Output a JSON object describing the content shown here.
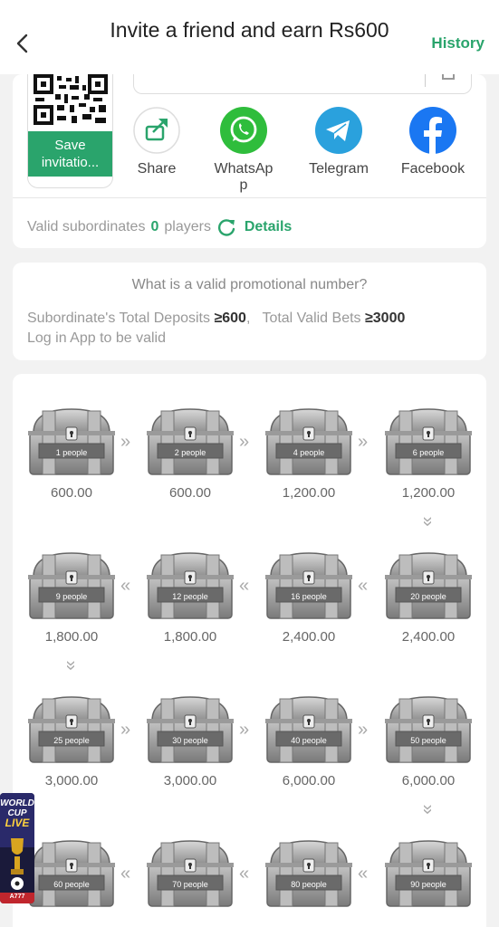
{
  "header": {
    "title": "Invite a friend and earn Rs600",
    "history_label": "History"
  },
  "invite": {
    "save_label": "Save invitatio...",
    "share_options": [
      {
        "label": "Share",
        "icon": "share-icon"
      },
      {
        "label": "WhatsAp p",
        "icon": "whatsapp-icon"
      },
      {
        "label": "Telegram",
        "icon": "telegram-icon"
      },
      {
        "label": "Facebook",
        "icon": "facebook-icon"
      }
    ],
    "valid_prefix": "Valid subordinates",
    "valid_count": "0",
    "valid_suffix": "players",
    "details_label": "Details"
  },
  "rules": {
    "title": "What is a valid promotional number?",
    "line1_a": "Subordinate's Total Deposits",
    "line1_b": "≥600",
    "line1_c": "Total Valid Bets",
    "line1_d": "≥3000",
    "line2": "Log in App to be valid"
  },
  "chests": [
    {
      "people": "1 people",
      "amount": "600.00"
    },
    {
      "people": "2 people",
      "amount": "600.00"
    },
    {
      "people": "4 people",
      "amount": "1,200.00"
    },
    {
      "people": "6 people",
      "amount": "1,200.00"
    },
    {
      "people": "20 people",
      "amount": "2,400.00"
    },
    {
      "people": "16 people",
      "amount": "2,400.00"
    },
    {
      "people": "12 people",
      "amount": "1,800.00"
    },
    {
      "people": "9 people",
      "amount": "1,800.00"
    },
    {
      "people": "25 people",
      "amount": "3,000.00"
    },
    {
      "people": "30 people",
      "amount": "3,000.00"
    },
    {
      "people": "40 people",
      "amount": "6,000.00"
    },
    {
      "people": "50 people",
      "amount": "6,000.00"
    },
    {
      "people": "90 people",
      "amount": ""
    },
    {
      "people": "80 people",
      "amount": ""
    },
    {
      "people": "70 people",
      "amount": ""
    },
    {
      "people": "60 people",
      "amount": ""
    }
  ],
  "float_badge": {
    "line1": "WORLD",
    "line2": "CUP",
    "line3": "LIVE",
    "tag": "A777"
  },
  "colors": {
    "accent": "#2aa46c",
    "whatsapp": "#2fbd3c",
    "telegram": "#2aa1dd",
    "facebook": "#1a77f2"
  }
}
